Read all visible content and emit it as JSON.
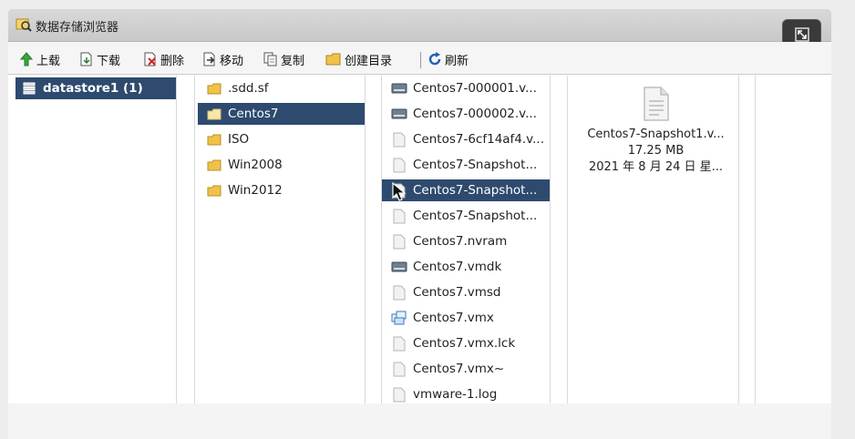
{
  "window": {
    "title": "数据存储浏览器"
  },
  "toolbar": {
    "upload": "上载",
    "download": "下载",
    "delete": "删除",
    "move": "移动",
    "copy": "复制",
    "create_dir": "创建目录",
    "refresh": "刷新"
  },
  "datastores": [
    {
      "label": "datastore1 (1)",
      "selected": true
    }
  ],
  "folders": [
    {
      "label": ".sdd.sf"
    },
    {
      "label": "Centos7",
      "selected": true
    },
    {
      "label": "ISO"
    },
    {
      "label": "Win2008"
    },
    {
      "label": "Win2012"
    }
  ],
  "files": [
    {
      "label": "Centos7-000001.v...",
      "icon": "disk-icon"
    },
    {
      "label": "Centos7-000002.v...",
      "icon": "disk-icon"
    },
    {
      "label": "Centos7-6cf14af4.v...",
      "icon": "file-icon"
    },
    {
      "label": "Centos7-Snapshot...",
      "icon": "file-icon"
    },
    {
      "label": "Centos7-Snapshot...",
      "icon": "file-icon",
      "selected": true
    },
    {
      "label": "Centos7-Snapshot...",
      "icon": "file-icon"
    },
    {
      "label": "Centos7.nvram",
      "icon": "file-icon"
    },
    {
      "label": "Centos7.vmdk",
      "icon": "disk-icon"
    },
    {
      "label": "Centos7.vmsd",
      "icon": "file-icon"
    },
    {
      "label": "Centos7.vmx",
      "icon": "vm-icon"
    },
    {
      "label": "Centos7.vmx.lck",
      "icon": "file-icon"
    },
    {
      "label": "Centos7.vmx~",
      "icon": "file-icon"
    },
    {
      "label": "vmware-1.log",
      "icon": "file-icon"
    }
  ],
  "preview": {
    "name": "Centos7-Snapshot1.v...",
    "size": "17.25 MB",
    "date": "2021 年 8 月 24 日 星..."
  },
  "colors": {
    "selection": "#2e4a6e",
    "folder": "#f0c24a",
    "titlebar": "#cfcfcf"
  }
}
